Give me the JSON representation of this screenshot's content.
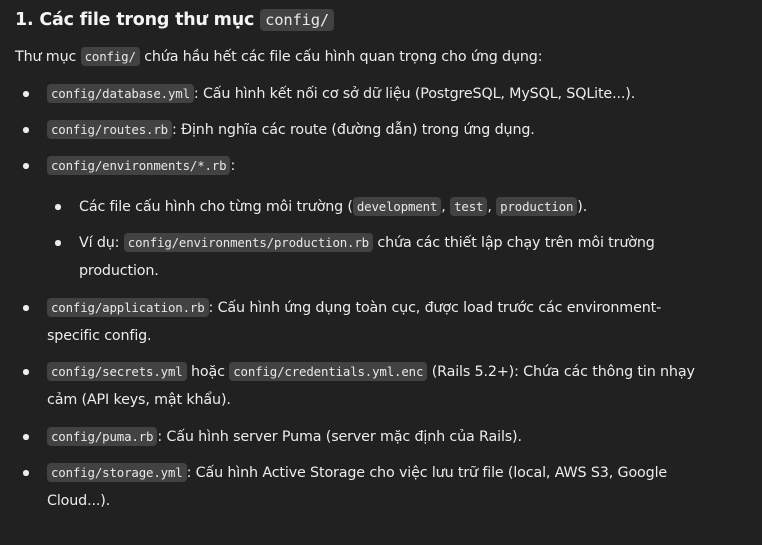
{
  "heading": {
    "text": "1. Các file trong thư mục",
    "code": "config/"
  },
  "intro": {
    "before": "Thư mục",
    "code": "config/",
    "after": "chứa hầu hết các file cấu hình quan trọng cho ứng dụng:"
  },
  "items": [
    {
      "code": "config/database.yml",
      "text": ": Cấu hình kết nối cơ sở dữ liệu (PostgreSQL, MySQL, SQLite...)."
    },
    {
      "code": "config/routes.rb",
      "text": ": Định nghĩa các route (đường dẫn) trong ứng dụng."
    },
    {
      "code": "config/environments/*.rb",
      "text": ":"
    },
    {
      "code": "config/application.rb",
      "text1": ": Cấu hình ứng dụng toàn cục, được load trước các environment-",
      "text2": "specific config."
    },
    {
      "code": "config/secrets.yml",
      "mid": "hoặc",
      "code2": "config/credentials.yml.enc",
      "text1": "(Rails 5.2+): Chứa các thông tin nhạy",
      "text2": "cảm (API keys, mật khẩu)."
    },
    {
      "code": "config/puma.rb",
      "text": ": Cấu hình server Puma (server mặc định của Rails)."
    },
    {
      "code": "config/storage.yml",
      "text1": ": Cấu hình Active Storage cho việc lưu trữ file (local, AWS S3, Google",
      "text2": "Cloud...)."
    }
  ],
  "sub_items": [
    {
      "text": "Các file cấu hình cho từng môi trường (",
      "codes": [
        "development",
        "test",
        "production"
      ],
      "sep": ",",
      "end": ")."
    },
    {
      "label": "Ví dụ:",
      "code": "config/environments/production.rb",
      "text1": "chứa các thiết lập chạy trên môi trường",
      "text2": "production."
    }
  ]
}
